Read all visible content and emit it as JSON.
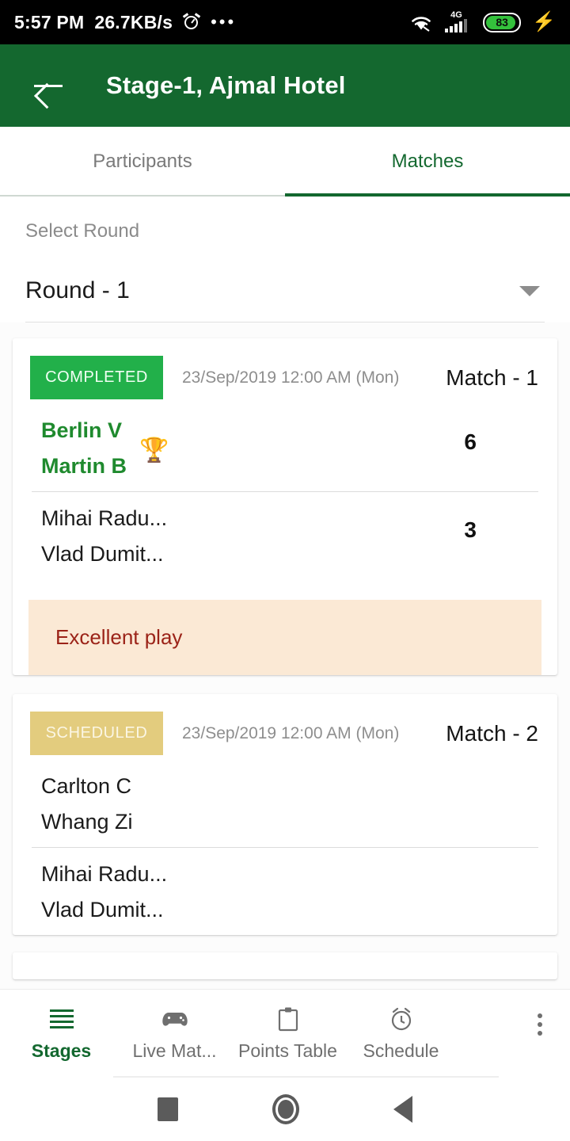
{
  "status_bar": {
    "time": "5:57 PM",
    "network_speed": "26.7KB/s",
    "alarm_icon": "alarm-icon",
    "more_dots": "•••",
    "wifi_icon": "wifi-icon",
    "signal_label": "4G",
    "battery_percent": "83",
    "charging_icon": "charging-bolt-icon"
  },
  "app_bar": {
    "back_icon": "back-arrow-icon",
    "title": "Stage-1, Ajmal Hotel",
    "background_color": "#14682f"
  },
  "tabs": {
    "items": [
      {
        "label": "Participants",
        "active": false
      },
      {
        "label": "Matches",
        "active": true
      }
    ],
    "active_color": "#13682f",
    "inactive_color": "#7a7a7a"
  },
  "round_select": {
    "label": "Select Round",
    "value": "Round - 1",
    "caret_icon": "chevron-down-icon"
  },
  "matches": [
    {
      "status": "COMPLETED",
      "status_color": "#22b04a",
      "date": "23/Sep/2019 12:00 AM (Mon)",
      "match_label": "Match - 1",
      "team_a": {
        "players": [
          "Berlin V",
          "Martin B"
        ],
        "score": "6",
        "winner": true,
        "trophy_icon": "trophy-icon"
      },
      "team_b": {
        "players": [
          "Mihai Radu...",
          "Vlad Dumit..."
        ],
        "score": "3",
        "winner": false
      },
      "comment": "Excellent play",
      "comment_bg": "#fbe9d5",
      "comment_color": "#9b2318"
    },
    {
      "status": "SCHEDULED",
      "status_color": "#e3cc7e",
      "date": "23/Sep/2019 12:00 AM (Mon)",
      "match_label": "Match - 2",
      "team_a": {
        "players": [
          "Carlton C",
          "Whang Zi"
        ],
        "score": "",
        "winner": false
      },
      "team_b": {
        "players": [
          "Mihai Radu...",
          "Vlad Dumit..."
        ],
        "score": "",
        "winner": false
      },
      "comment": "",
      "comment_bg": "",
      "comment_color": ""
    }
  ],
  "bottom_nav": {
    "items": [
      {
        "label": "Stages",
        "icon": "hamburger-menu-icon",
        "active": true
      },
      {
        "label": "Live Mat...",
        "icon": "gamepad-icon",
        "active": false
      },
      {
        "label": "Points Table",
        "icon": "clipboard-icon",
        "active": false
      },
      {
        "label": "Schedule",
        "icon": "alarm-clock-icon",
        "active": false
      }
    ],
    "overflow_icon": "overflow-menu-icon"
  },
  "android_nav": {
    "recents_icon": "square-recents-icon",
    "home_icon": "circle-home-icon",
    "back_icon": "triangle-back-icon"
  }
}
